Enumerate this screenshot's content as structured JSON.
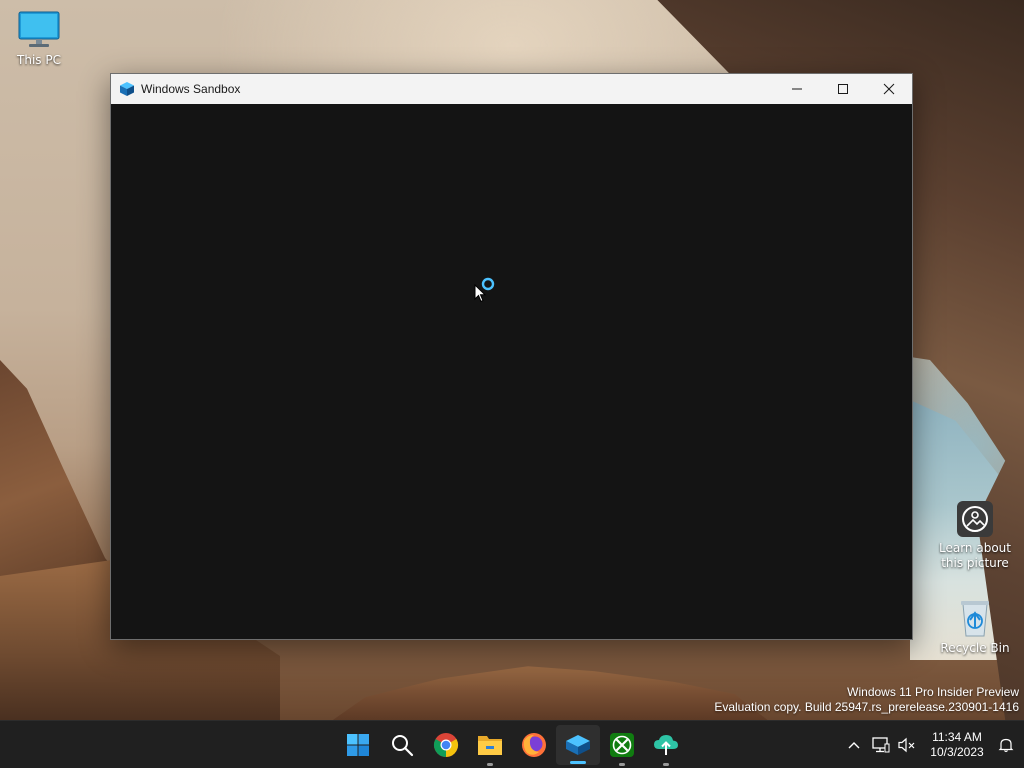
{
  "desktop": {
    "icons": [
      {
        "label": "This PC"
      },
      {
        "label": "Learn about this picture"
      },
      {
        "label": "Recycle Bin"
      }
    ]
  },
  "window": {
    "title": "Windows Sandbox",
    "minimize_icon": "minimize-icon",
    "maximize_icon": "maximize-icon",
    "close_icon": "close-icon"
  },
  "watermark": {
    "line1": "Windows 11 Pro Insider Preview",
    "line2": "Evaluation copy. Build 25947.rs_prerelease.230901-1416"
  },
  "taskbar": {
    "apps": [
      "start-icon",
      "search-icon",
      "chrome-icon",
      "file-explorer-icon",
      "firefox-icon",
      "windows-sandbox-icon",
      "xbox-icon",
      "upload-cloud-icon"
    ],
    "clock": {
      "time": "11:34 AM",
      "date": "10/3/2023"
    }
  },
  "colors": {
    "accent": "#4cc2ff",
    "taskbar": "#202020",
    "window_content": "#141414",
    "titlebar": "#f3f3f3"
  }
}
